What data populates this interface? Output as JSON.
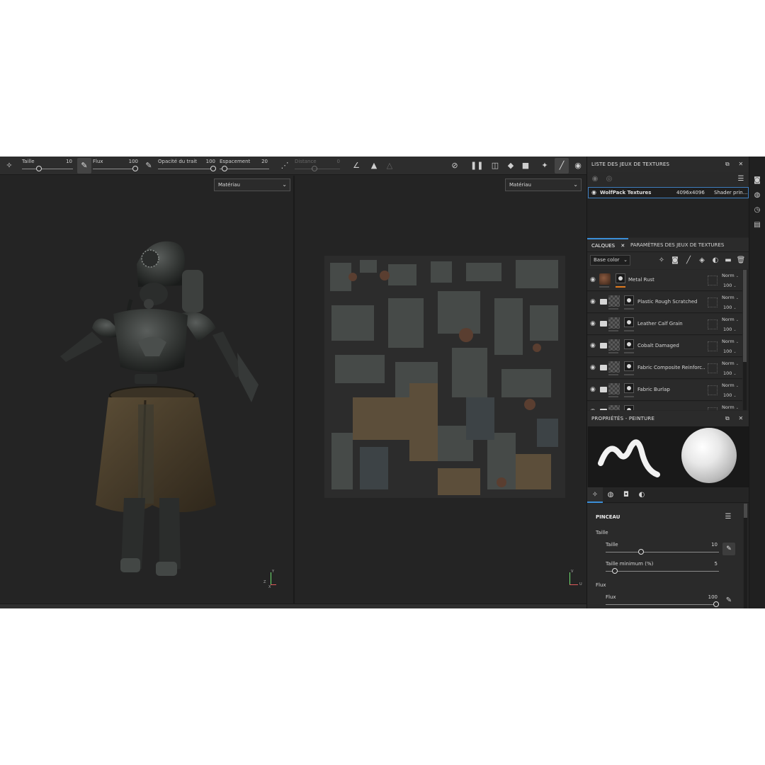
{
  "toolbar": {
    "size_label": "Taille",
    "size_value": "10",
    "flow_label": "Flux",
    "flow_value": "100",
    "stroke_opacity_label": "Opacité du trait",
    "stroke_opacity_value": "100",
    "spacing_label": "Espacement",
    "spacing_value": "20",
    "distance_label": "Distance",
    "distance_value": "0"
  },
  "viewports": {
    "left_mode": "Matériau",
    "right_mode": "Matériau",
    "gizmo_3d": {
      "y": "Y",
      "z": "Z",
      "x": "X"
    },
    "gizmo_2d": {
      "v": "V",
      "u": "U"
    }
  },
  "texture_sets": {
    "title": "LISTE DES JEUX DE TEXTURES",
    "row": {
      "name": "WolfPack Textures",
      "resolution": "4096x4096",
      "shader": "Shader prin..."
    }
  },
  "layers_panel": {
    "tab_layers": "CALQUES",
    "tab_params": "PARAMÈTRES DES JEUX DE TEXTURES",
    "channel": "Base color",
    "items": [
      {
        "name": "Metal Rust",
        "blend": "Norm",
        "opacity": "100"
      },
      {
        "name": "Plastic Rough Scratched",
        "blend": "Norm",
        "opacity": "100"
      },
      {
        "name": "Leather Calf Grain",
        "blend": "Norm",
        "opacity": "100"
      },
      {
        "name": "Cobalt Damaged",
        "blend": "Norm",
        "opacity": "100"
      },
      {
        "name": "Fabric Composite Reinforc...",
        "blend": "Norm",
        "opacity": "100"
      },
      {
        "name": "Fabric Burlap",
        "blend": "Norm",
        "opacity": "100"
      },
      {
        "name": "",
        "blend": "Norm",
        "opacity": ""
      }
    ]
  },
  "properties": {
    "title": "PROPRIÉTÉS - PEINTURE",
    "section": "PINCEAU",
    "size_group": "Taille",
    "size_label": "Taille",
    "size_value": "10",
    "min_size_label": "Taille minimum (%)",
    "min_size_value": "5",
    "flow_group": "Flux",
    "flow_label": "Flux",
    "flow_value": "100"
  },
  "colors": {
    "accent": "#3b8fd8",
    "selected_layer_bar": "#e07a1f"
  }
}
